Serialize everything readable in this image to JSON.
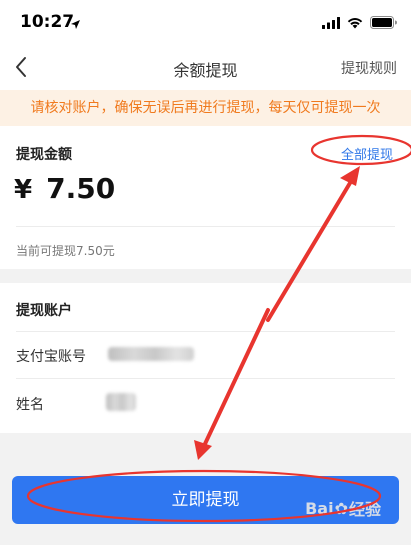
{
  "status_bar": {
    "time": "10:27"
  },
  "nav": {
    "title": "余额提现",
    "right_label": "提现规则"
  },
  "notice": {
    "text": "请核对账户，确保无误后再进行提现，每天仅可提现一次"
  },
  "amount_section": {
    "label": "提现金额",
    "withdraw_all_label": "全部提现",
    "currency_symbol": "¥",
    "amount": "7.50",
    "available_text": "当前可提现7.50元"
  },
  "account_section": {
    "title": "提现账户",
    "alipay_label": "支付宝账号",
    "name_label": "姓名"
  },
  "submit": {
    "label": "立即提现"
  },
  "watermark": {
    "text_a": "Bai",
    "text_b": "经验"
  },
  "colors": {
    "accent": "#2f77f1",
    "notice_text": "#f07a1e",
    "notice_bg": "#fdf1e4",
    "annotation_red": "#e8352f"
  }
}
